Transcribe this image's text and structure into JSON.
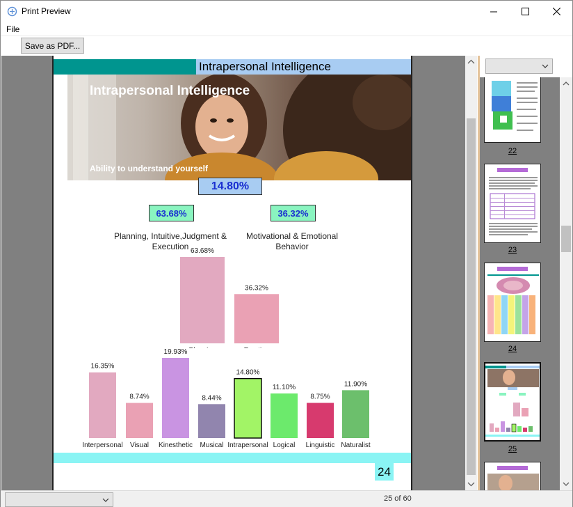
{
  "window": {
    "title": "Print Preview"
  },
  "menu": {
    "file": "File"
  },
  "toolbar": {
    "save_pdf": "Save as PDF..."
  },
  "page": {
    "header_title": "Intrapersonal Intelligence",
    "photo_title": "Intrapersonal Intelligence",
    "photo_subtitle": "Ability to understand yourself",
    "main_percent": "14.80%",
    "left_percent": "63.68%",
    "right_percent": "36.32%",
    "left_category": "Planning, Intuitive,Judgment & Execution",
    "right_category": "Motivational & Emotional Behavior",
    "page_number": "24"
  },
  "chart_data": [
    {
      "type": "bar",
      "categories": [
        "Planning",
        "Emotion"
      ],
      "values": [
        63.68,
        36.32
      ],
      "value_labels": [
        "63.68%",
        "36.32%"
      ],
      "colors": [
        "#e2a9c0",
        "#eaa1b4"
      ]
    },
    {
      "type": "bar",
      "categories": [
        "Interpersonal",
        "Visual",
        "Kinesthetic",
        "Musical",
        "Intrapersonal",
        "Logical",
        "Linguistic",
        "Naturalist"
      ],
      "values": [
        16.35,
        8.74,
        19.93,
        8.44,
        14.8,
        11.1,
        8.75,
        11.9
      ],
      "value_labels": [
        "16.35%",
        "8.74%",
        "19.93%",
        "8.44%",
        "14.80%",
        "11.10%",
        "8.75%",
        "11.90%"
      ],
      "colors": [
        "#e2a9c0",
        "#eaa1b4",
        "#c994e2",
        "#9185ae",
        "#a2f466",
        "#6cea6c",
        "#d73a6e",
        "#6cbf6c"
      ],
      "highlight": "Intrapersonal"
    }
  ],
  "thumbnails": [
    {
      "label": "22"
    },
    {
      "label": "23"
    },
    {
      "label": "24"
    },
    {
      "label": "25"
    }
  ],
  "status": {
    "page_indicator": "25 of 60"
  }
}
